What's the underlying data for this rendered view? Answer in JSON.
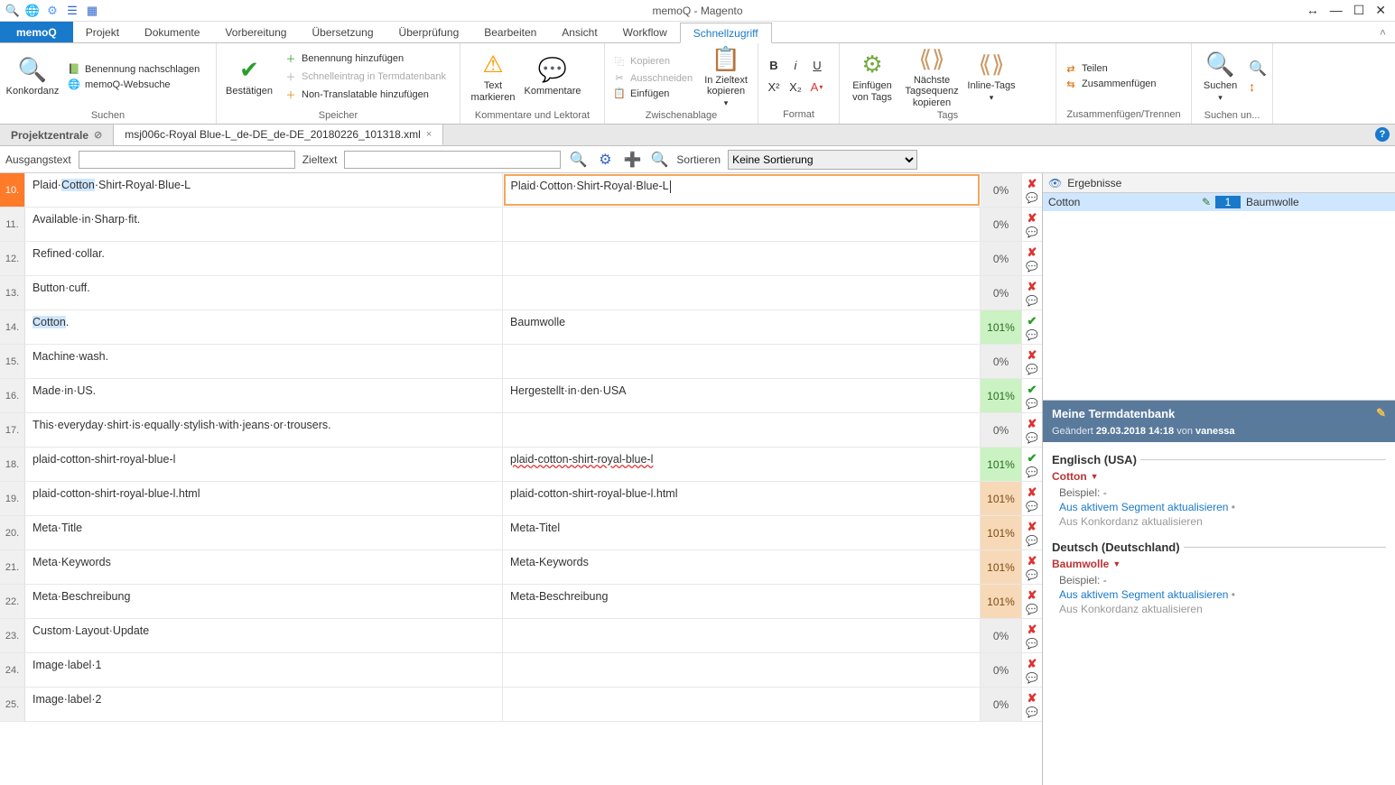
{
  "window": {
    "title": "memoQ - Magento"
  },
  "qat_icons": [
    "search-icon",
    "globe-icon",
    "gear-icon",
    "ribbon-icon",
    "grid-icon"
  ],
  "menu": {
    "app": "memoQ",
    "tabs": [
      "Projekt",
      "Dokumente",
      "Vorbereitung",
      "Übersetzung",
      "Überprüfung",
      "Bearbeiten",
      "Ansicht",
      "Workflow",
      "Schnellzugriff"
    ],
    "active": "Schnellzugriff"
  },
  "ribbon": {
    "suchen": {
      "label": "Suchen",
      "konkordanz": "Konkordanz",
      "benennung_nachschlagen": "Benennung nachschlagen",
      "websuche": "memoQ-Websuche"
    },
    "speicher": {
      "label": "Speicher",
      "bestaetigen": "Bestätigen",
      "benennung_hinzu": "Benennung hinzufügen",
      "schnelleintrag": "Schnelleintrag in Termdatenbank",
      "nontrans": "Non-Translatable hinzufügen"
    },
    "komm": {
      "label": "Kommentare und Lektorat",
      "text_markieren": "Text markieren",
      "kommentare": "Kommentare"
    },
    "zwisch": {
      "label": "Zwischenablage",
      "kopieren": "Kopieren",
      "ausschneiden": "Ausschneiden",
      "einfuegen": "Einfügen",
      "zieltext": "In Zieltext kopieren"
    },
    "format": {
      "label": "Format"
    },
    "tags": {
      "label": "Tags",
      "einf_tags": "Einfügen von Tags",
      "naechste": "Nächste Tagsequenz kopieren",
      "inline": "Inline-Tags"
    },
    "zt": {
      "label": "Zusammenfügen/Trennen",
      "teilen": "Teilen",
      "zusammen": "Zusammenfügen"
    },
    "such2": {
      "label": "Suchen un...",
      "suchen": "Suchen"
    }
  },
  "doctabs": {
    "projekt": "Projektzentrale",
    "file": "msj006c-Royal Blue-L_de-DE_de-DE_20180226_101318.xml"
  },
  "filter": {
    "src_label": "Ausgangstext",
    "tgt_label": "Zieltext",
    "sort_label": "Sortieren",
    "sort_value": "Keine Sortierung"
  },
  "rows": [
    {
      "n": "10.",
      "src_pre": "Plaid·",
      "src_hl": "Cotton",
      "src_post": "·Shirt-Royal·Blue-L",
      "tgt": "Plaid·Cotton·Shirt-Royal·Blue-L",
      "pct": "0%",
      "pcls": "p0",
      "conf": "x",
      "editing": true,
      "active": true
    },
    {
      "n": "11.",
      "src": "Available·in·Sharp·fit.",
      "tgt": "",
      "pct": "0%",
      "pcls": "p0",
      "conf": "x"
    },
    {
      "n": "12.",
      "src": "Refined·collar.",
      "tgt": "",
      "pct": "0%",
      "pcls": "p0",
      "conf": "x"
    },
    {
      "n": "13.",
      "src": "Button·cuff.",
      "tgt": "",
      "pct": "0%",
      "pcls": "p0",
      "conf": "x"
    },
    {
      "n": "14.",
      "src_hl_full": "Cotton",
      "src_post2": ".",
      "tgt": "Baumwolle",
      "pct": "101%",
      "pcls": "p101g",
      "conf": "v"
    },
    {
      "n": "15.",
      "src": "Machine·wash.",
      "tgt": "",
      "pct": "0%",
      "pcls": "p0",
      "conf": "x"
    },
    {
      "n": "16.",
      "src": "Made·in·US.",
      "tgt": "Hergestellt·in·den·USA",
      "pct": "101%",
      "pcls": "p101g",
      "conf": "v"
    },
    {
      "n": "17.",
      "src": "This·everyday·shirt·is·equally·stylish·with·jeans·or·trousers.",
      "tgt": "",
      "pct": "0%",
      "pcls": "p0",
      "conf": "x"
    },
    {
      "n": "18.",
      "src": "plaid-cotton-shirt-royal-blue-l",
      "tgt": "plaid-cotton-shirt-royal-blue-l",
      "tgt_spell": true,
      "pct": "101%",
      "pcls": "p101g",
      "conf": "v"
    },
    {
      "n": "19.",
      "src": "plaid-cotton-shirt-royal-blue-l.html",
      "tgt": "plaid-cotton-shirt-royal-blue-l.html",
      "pct": "101%",
      "pcls": "p101o",
      "conf": "x"
    },
    {
      "n": "20.",
      "src": "Meta·Title",
      "tgt": "Meta-Titel",
      "pct": "101%",
      "pcls": "p101o",
      "conf": "x"
    },
    {
      "n": "21.",
      "src": "Meta·Keywords",
      "tgt": "Meta-Keywords",
      "pct": "101%",
      "pcls": "p101o",
      "conf": "x"
    },
    {
      "n": "22.",
      "src": "Meta·Beschreibung",
      "tgt": "Meta-Beschreibung",
      "pct": "101%",
      "pcls": "p101o",
      "conf": "x"
    },
    {
      "n": "23.",
      "src": "Custom·Layout·Update",
      "tgt": "",
      "pct": "0%",
      "pcls": "p0",
      "conf": "x"
    },
    {
      "n": "24.",
      "src": "Image·label·1",
      "tgt": "",
      "pct": "0%",
      "pcls": "p0",
      "conf": "x"
    },
    {
      "n": "25.",
      "src": "Image·label·2",
      "tgt": "",
      "pct": "0%",
      "pcls": "p0",
      "conf": "x"
    }
  ],
  "results": {
    "header": "Ergebnisse",
    "row": {
      "term": "Cotton",
      "num": "1",
      "trans": "Baumwolle"
    }
  },
  "term": {
    "title": "Meine Termdatenbank",
    "changed_pre": "Geändert ",
    "changed_date": "29.03.2018 14:18",
    "changed_by_pre": " von ",
    "changed_by": "vanessa",
    "lang1": "Englisch (USA)",
    "word1": "Cotton",
    "beispiel": "Beispiel: -",
    "link1": "Aus aktivem Segment aktualisieren",
    "link2": "Aus Konkordanz aktualisieren",
    "lang2": "Deutsch (Deutschland)",
    "word2": "Baumwolle"
  }
}
